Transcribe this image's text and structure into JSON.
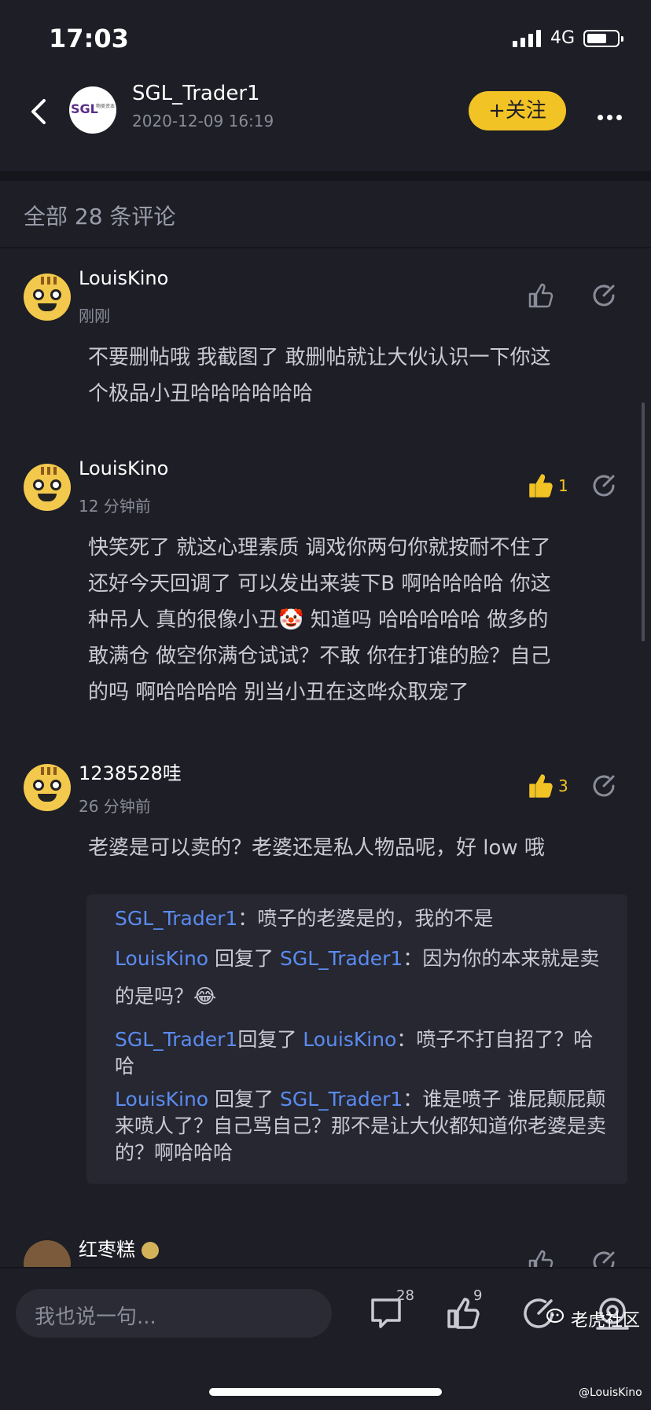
{
  "status_bar": {
    "time": "17:03",
    "network": "4G"
  },
  "header": {
    "author": "SGL_Trader1",
    "post_time": "2020-12-09 16:19",
    "follow_label": "+关注",
    "logo_text": "SGL",
    "logo_subtext": "物类资本"
  },
  "comments_header": "全部 28 条评论",
  "comments": [
    {
      "name": "LouisKino",
      "time": "刚刚",
      "likes": "",
      "text": "不要删帖哦 我截图了 敢删帖就让大伙认识一下你这\n个极品小丑哈哈哈哈哈哈"
    },
    {
      "name": "LouisKino",
      "time": "12 分钟前",
      "likes": "1",
      "text": "快笑死了 就这心理素质 调戏你两句你就按耐不住了\n还好今天回调了 可以发出来装下B 啊哈哈哈哈 你这\n种吊人 真的很像小丑🤡 知道吗 哈哈哈哈哈 做多的\n敢满仓 做空你满仓试试？不敢 你在打谁的脸？自己\n的吗 啊哈哈哈哈 别当小丑在这哗众取宠了"
    },
    {
      "name": "1238528哇",
      "time": "26 分钟前",
      "likes": "3",
      "text": "老婆是可以卖的？老婆还是私人物品呢，好 low 哦"
    },
    {
      "name": "红枣糕",
      "time": "",
      "likes": "",
      "text": ""
    }
  ],
  "replies": [
    {
      "user": "SGL_Trader1",
      "replied": "",
      "target": "",
      "sep": "：",
      "text": "喷子的老婆是的，我的不是"
    },
    {
      "user": "LouisKino",
      "replied": " 回复了 ",
      "target": "SGL_Trader1",
      "sep": "：",
      "text": "因为你的本来就是卖的是吗？😂"
    },
    {
      "user": "SGL_Trader1",
      "replied": "回复了 ",
      "target": "LouisKino",
      "sep": "：",
      "text": "喷子不打自招了？哈哈"
    },
    {
      "user": "LouisKino",
      "replied": " 回复了 ",
      "target": "SGL_Trader1",
      "sep": "：",
      "text": "谁是喷子 谁屁颠屁颠来喷人了？自己骂自己？那不是让大伙都知道你老婆是卖的？啊哈哈哈"
    }
  ],
  "bottom_bar": {
    "placeholder": "我也说一句...",
    "comment_count": "28",
    "like_count": "9"
  },
  "watermark": {
    "brand": "老虎社区",
    "user": "@LouisKino"
  },
  "colors": {
    "accent": "#f2c325",
    "link": "#5b8bf0",
    "background": "#1d1e26"
  }
}
